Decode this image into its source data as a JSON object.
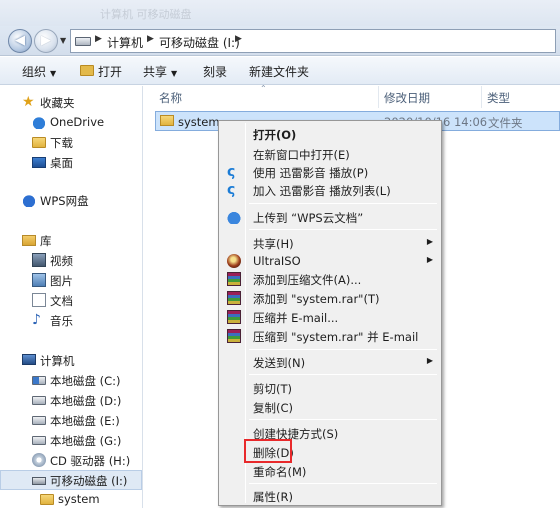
{
  "window": {
    "blurred_title": "计算机  可移动磁盘"
  },
  "address": {
    "crumbs": [
      "计算机",
      "可移动磁盘 (I:)"
    ]
  },
  "toolbar": {
    "organize": "组织",
    "open": "打开",
    "share": "共享",
    "burn": "刻录",
    "new_folder": "新建文件夹"
  },
  "nav": {
    "favorites": "收藏夹",
    "onedrive": "OneDrive",
    "downloads": "下载",
    "desktop": "桌面",
    "wps": "WPS网盘",
    "libraries": "库",
    "videos": "视频",
    "pictures": "图片",
    "documents": "文档",
    "music": "音乐",
    "computer": "计算机",
    "drive_c": "本地磁盘 (C:)",
    "drive_d": "本地磁盘 (D:)",
    "drive_e": "本地磁盘 (E:)",
    "drive_g": "本地磁盘 (G:)",
    "drive_h": "CD 驱动器 (H:)",
    "drive_i": "可移动磁盘 (I:)",
    "system": "system"
  },
  "columns": {
    "name": "名称",
    "modified": "修改日期",
    "type": "类型"
  },
  "file": {
    "name": "system",
    "date": "2020/10/16 14:06",
    "type": "文件夹"
  },
  "menu": {
    "open": "打开(O)",
    "open_new_window": "在新窗口中打开(E)",
    "xl_play": "使用 迅雷影音 播放(P)",
    "xl_add": "加入 迅雷影音 播放列表(L)",
    "upload_wps": "上传到 “WPS云文档”",
    "share": "共享(H)",
    "ultraiso": "UltraISO",
    "add_archive": "添加到压缩文件(A)...",
    "add_system_rar": "添加到 \"system.rar\"(T)",
    "compress_email": "压缩并 E-mail...",
    "compress_system_email": "压缩到 \"system.rar\" 并 E-mail",
    "send_to": "发送到(N)",
    "cut": "剪切(T)",
    "copy": "复制(C)",
    "create_shortcut": "创建快捷方式(S)",
    "delete": "删除(D)",
    "rename": "重命名(M)",
    "properties": "属性(R)"
  },
  "colors": {
    "highlight": "#e8292b",
    "selection": "#cce3fb"
  }
}
